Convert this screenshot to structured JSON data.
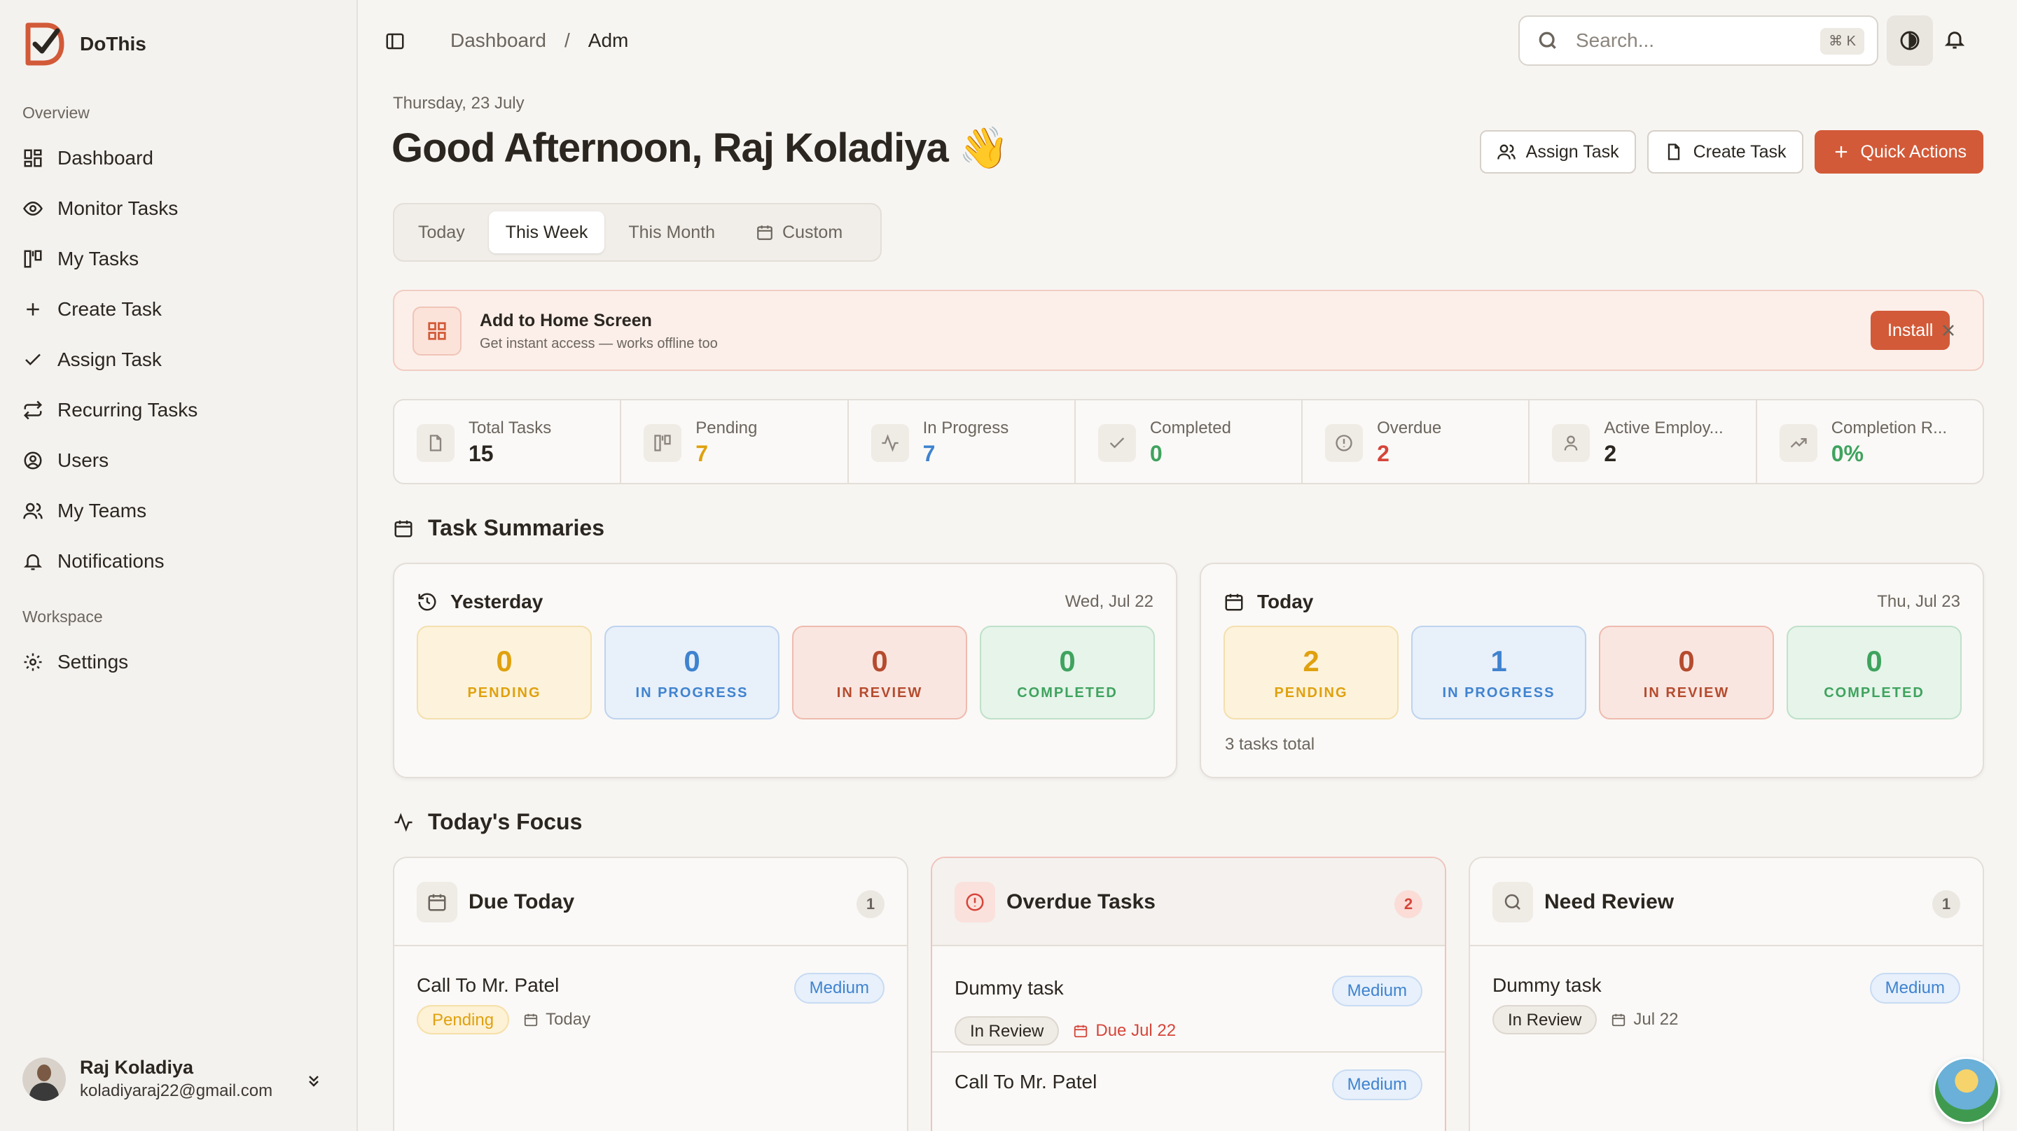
{
  "brand": {
    "name": "DoThis"
  },
  "sidebar": {
    "overview_label": "Overview",
    "workspace_label": "Workspace",
    "items": [
      {
        "label": "Dashboard",
        "icon": "dashboard-icon"
      },
      {
        "label": "Monitor Tasks",
        "icon": "eye-icon"
      },
      {
        "label": "My Tasks",
        "icon": "kanban-icon"
      },
      {
        "label": "Create Task",
        "icon": "plus-icon"
      },
      {
        "label": "Assign Task",
        "icon": "check-icon"
      },
      {
        "label": "Recurring Tasks",
        "icon": "repeat-icon"
      },
      {
        "label": "Users",
        "icon": "user-circle-icon"
      },
      {
        "label": "My Teams",
        "icon": "users-icon"
      },
      {
        "label": "Notifications",
        "icon": "bell-icon"
      }
    ],
    "workspace_items": [
      {
        "label": "Settings",
        "icon": "gear-icon"
      }
    ],
    "user": {
      "name": "Raj Koladiya",
      "email": "koladiyaraj22@gmail.com"
    }
  },
  "topbar": {
    "breadcrumb": [
      "Dashboard",
      "/",
      "Adm"
    ],
    "search_placeholder": "Search...",
    "search_shortcut": "⌘ K"
  },
  "header": {
    "date": "Thursday, 23 July",
    "greeting": "Good Afternoon, Raj Koladiya 👋",
    "assign_label": "Assign Task",
    "create_label": "Create Task",
    "quick_label": "Quick Actions"
  },
  "range_tabs": [
    "Today",
    "This Week",
    "This Month",
    "Custom"
  ],
  "range_active": "This Week",
  "install_banner": {
    "title": "Add to Home Screen",
    "subtitle": "Get instant access — works offline too",
    "button": "Install"
  },
  "stats": [
    {
      "label": "Total Tasks",
      "value": "15",
      "color": "#2b2620",
      "icon": "file-icon"
    },
    {
      "label": "Pending",
      "value": "7",
      "color": "#e0a10f",
      "icon": "kanban-icon"
    },
    {
      "label": "In Progress",
      "value": "7",
      "color": "#3f83cf",
      "icon": "activity-icon"
    },
    {
      "label": "Completed",
      "value": "0",
      "color": "#3fa35e",
      "icon": "check-icon"
    },
    {
      "label": "Overdue",
      "value": "2",
      "color": "#d6453a",
      "icon": "alert-circle-icon"
    },
    {
      "label": "Active Employ...",
      "value": "2",
      "color": "#2b2620",
      "icon": "user-icon"
    },
    {
      "label": "Completion R...",
      "value": "0%",
      "color": "#3fa35e",
      "icon": "trending-up-icon"
    }
  ],
  "summaries": {
    "title": "Task Summaries",
    "yesterday": {
      "title": "Yesterday",
      "date": "Wed, Jul 22",
      "pending": "0",
      "in_progress": "0",
      "in_review": "0",
      "completed": "0"
    },
    "today": {
      "title": "Today",
      "date": "Thu, Jul 23",
      "pending": "2",
      "in_progress": "1",
      "in_review": "0",
      "completed": "0",
      "total": "3 tasks total"
    },
    "labels": {
      "pending": "PENDING",
      "in_progress": "IN PROGRESS",
      "in_review": "IN REVIEW",
      "completed": "COMPLETED"
    }
  },
  "focus": {
    "title": "Today's Focus",
    "due_today": {
      "title": "Due Today",
      "count": "1",
      "tasks": [
        {
          "name": "Call To Mr. Patel",
          "priority": "Medium",
          "status": "Pending",
          "due": "Today"
        }
      ]
    },
    "overdue": {
      "title": "Overdue Tasks",
      "count": "2",
      "tasks": [
        {
          "name": "Dummy task",
          "priority": "Medium",
          "status": "In Review",
          "due": "Due Jul 22"
        },
        {
          "name": "Call To Mr. Patel",
          "priority": "Medium",
          "status": "",
          "due": ""
        }
      ]
    },
    "need_review": {
      "title": "Need Review",
      "count": "1",
      "tasks": [
        {
          "name": "Dummy task",
          "priority": "Medium",
          "status": "In Review",
          "due": "Jul 22"
        }
      ]
    }
  },
  "colors": {
    "accent": "#d25a38",
    "pending": "#e0a10f",
    "progress": "#3f83cf",
    "review": "#b54b2e",
    "completed": "#3fa35e",
    "overdue": "#d6453a"
  }
}
